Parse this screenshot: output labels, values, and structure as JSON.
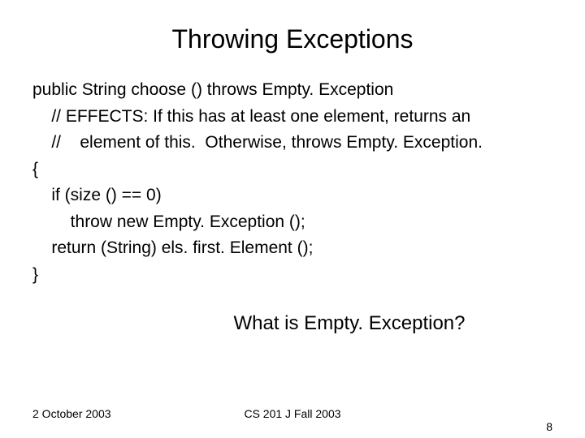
{
  "title": "Throwing Exceptions",
  "code": {
    "l1": "public String choose () throws Empty. Exception",
    "l2": "    // EFFECTS: If this has at least one element, returns an",
    "l3": "    //    element of this.  Otherwise, throws Empty. Exception.",
    "l4": "{",
    "l5": "    if (size () == 0)",
    "l6": "        throw new Empty. Exception ();",
    "l7": "    return (String) els. first. Element ();",
    "l8": "}"
  },
  "question": "What is Empty. Exception?",
  "footer": {
    "date": "2 October 2003",
    "course": "CS 201 J Fall 2003",
    "page": "8"
  }
}
